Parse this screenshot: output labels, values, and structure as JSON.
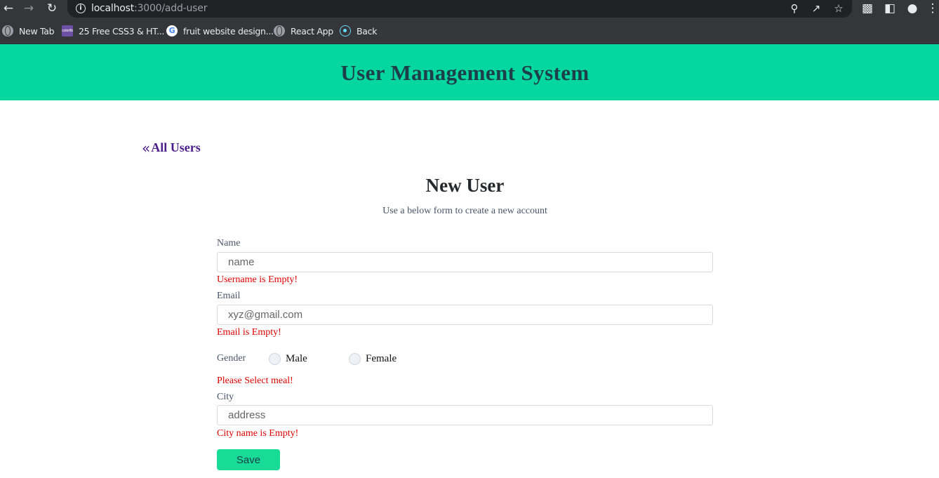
{
  "browser": {
    "url_host": "localhost",
    "url_path": ":3000/add-user",
    "bookmarks": [
      {
        "label": "New Tab",
        "icon": "globe-icon"
      },
      {
        "label": "25 Free CSS3 & HT...",
        "icon": "colorlib-icon",
        "icon_text": "colorlib"
      },
      {
        "label": "fruit website design...",
        "icon": "google-icon",
        "icon_text": "G"
      },
      {
        "label": "React App",
        "icon": "globe-icon"
      },
      {
        "label": "Back",
        "icon": "react-icon"
      }
    ]
  },
  "header": {
    "title": "User Management System",
    "color": "#06d6a0"
  },
  "back_link": {
    "label": "All Users",
    "icon": "double-chevron-left-icon"
  },
  "form": {
    "title": "New User",
    "subtitle": "Use a below form to create a new account",
    "name": {
      "label": "Name",
      "placeholder": "name",
      "error": "Username is Empty!"
    },
    "email": {
      "label": "Email",
      "placeholder": "xyz@gmail.com",
      "error": "Email is Empty!"
    },
    "gender": {
      "label": "Gender",
      "options": [
        "Male",
        "Female"
      ],
      "error": "Please Select meal!"
    },
    "city": {
      "label": "City",
      "placeholder": "address",
      "error": "City name is Empty!"
    },
    "save_label": "Save"
  },
  "colors": {
    "accent": "#06d6a0",
    "button": "#17db96",
    "error": "#e00000",
    "link": "#4d1f8c"
  }
}
